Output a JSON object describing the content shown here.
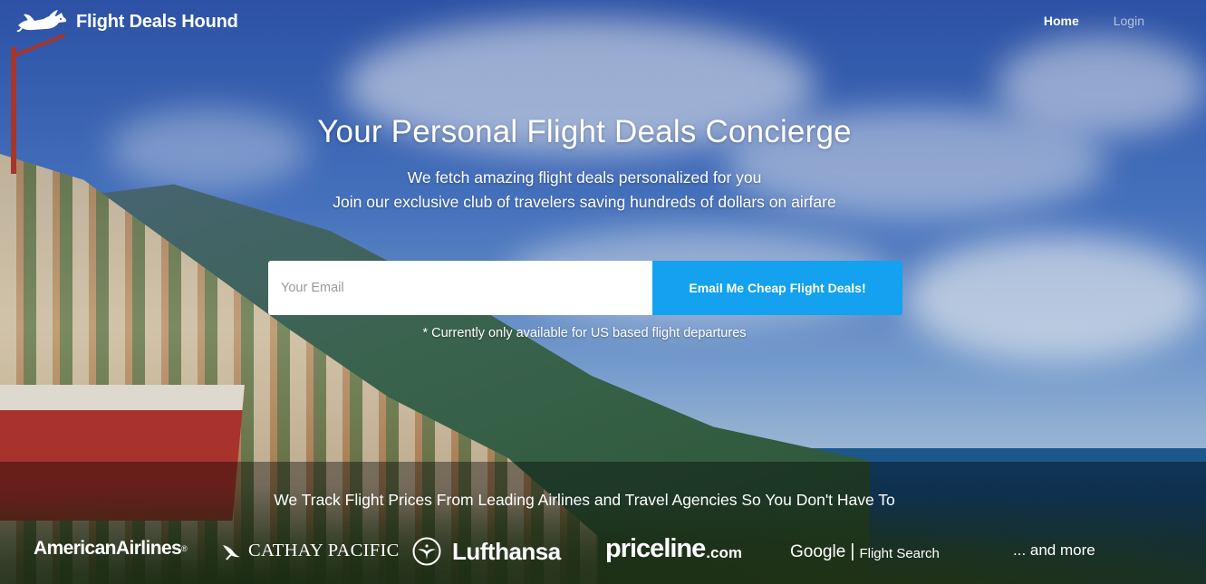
{
  "header": {
    "brand": "Flight Deals Hound",
    "logo_icon": "flying-dog-icon",
    "nav": [
      {
        "label": "Home",
        "active": true
      },
      {
        "label": "Login",
        "active": false
      }
    ]
  },
  "hero": {
    "title": "Your Personal Flight Deals Concierge",
    "subtitle_line1": "We fetch amazing flight deals personalized for you",
    "subtitle_line2": "Join our exclusive club of travelers saving hundreds of dollars on airfare",
    "signup": {
      "email_placeholder": "Your Email",
      "email_value": "",
      "button_label": "Email Me Cheap Flight Deals!"
    },
    "note": "* Currently only available for US based flight departures"
  },
  "partners": {
    "heading": "We Track Flight Prices From Leading Airlines and Travel Agencies So You Don't Have To",
    "items": [
      {
        "name": "AmericanAirlines",
        "mark": "®"
      },
      {
        "name": "CATHAY PACIFIC",
        "icon": "cathay-brushwing-icon"
      },
      {
        "name": "Lufthansa",
        "icon": "lufthansa-crane-icon"
      },
      {
        "name": "priceline",
        "suffix": ".com"
      },
      {
        "name": "Google",
        "separator": "|",
        "suffix": "Flight Search"
      }
    ],
    "more": "... and more"
  },
  "colors": {
    "cta": "#13a1f0",
    "text": "#ffffff",
    "input_bg": "#ffffff"
  }
}
